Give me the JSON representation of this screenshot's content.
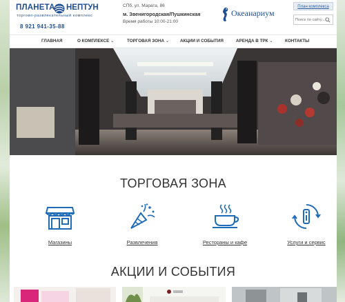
{
  "header": {
    "logo_part1": "ПЛАНЕТА",
    "logo_part2": "НЕПТУН",
    "logo_subtitle": "торгово-развлекательный комплекс",
    "phone": "8 921 941-35-88",
    "address": "СПб, ул. Марата, 86",
    "metro": "м. Звенигородская/Пушкинская",
    "hours": "Время работы 10:00-21:00",
    "oceanarium": "Океанариум",
    "plan_button": "План комплекса",
    "search_placeholder": "Поиск по сайту..."
  },
  "nav": {
    "items": [
      {
        "label": "ГЛАВНАЯ",
        "caret": ""
      },
      {
        "label": "О КОМПЛЕКСЕ",
        "caret": "⌄"
      },
      {
        "label": "ТОРГОВАЯ ЗОНА",
        "caret": "⌄"
      },
      {
        "label": "АКЦИИ И СОБЫТИЯ",
        "caret": ""
      },
      {
        "label": "АРЕНДА В ТРК",
        "caret": "⌄"
      },
      {
        "label": "КОНТАКТЫ",
        "caret": ""
      }
    ]
  },
  "trade_zone": {
    "title": "ТОРГОВАЯ ЗОНА",
    "categories": [
      {
        "label": "Магазины",
        "icon": "shop-icon"
      },
      {
        "label": "Развлечения",
        "icon": "party-popper-icon"
      },
      {
        "label": "Рестораны и кафе",
        "icon": "coffee-cup-icon"
      },
      {
        "label": "Услуги и сервис",
        "icon": "info-service-icon"
      }
    ]
  },
  "events": {
    "title": "АКЦИИ И СОБЫТИЯ"
  },
  "colors": {
    "brand_blue": "#1f4e95",
    "icon_blue": "#1e6bb8",
    "text": "#333333"
  }
}
